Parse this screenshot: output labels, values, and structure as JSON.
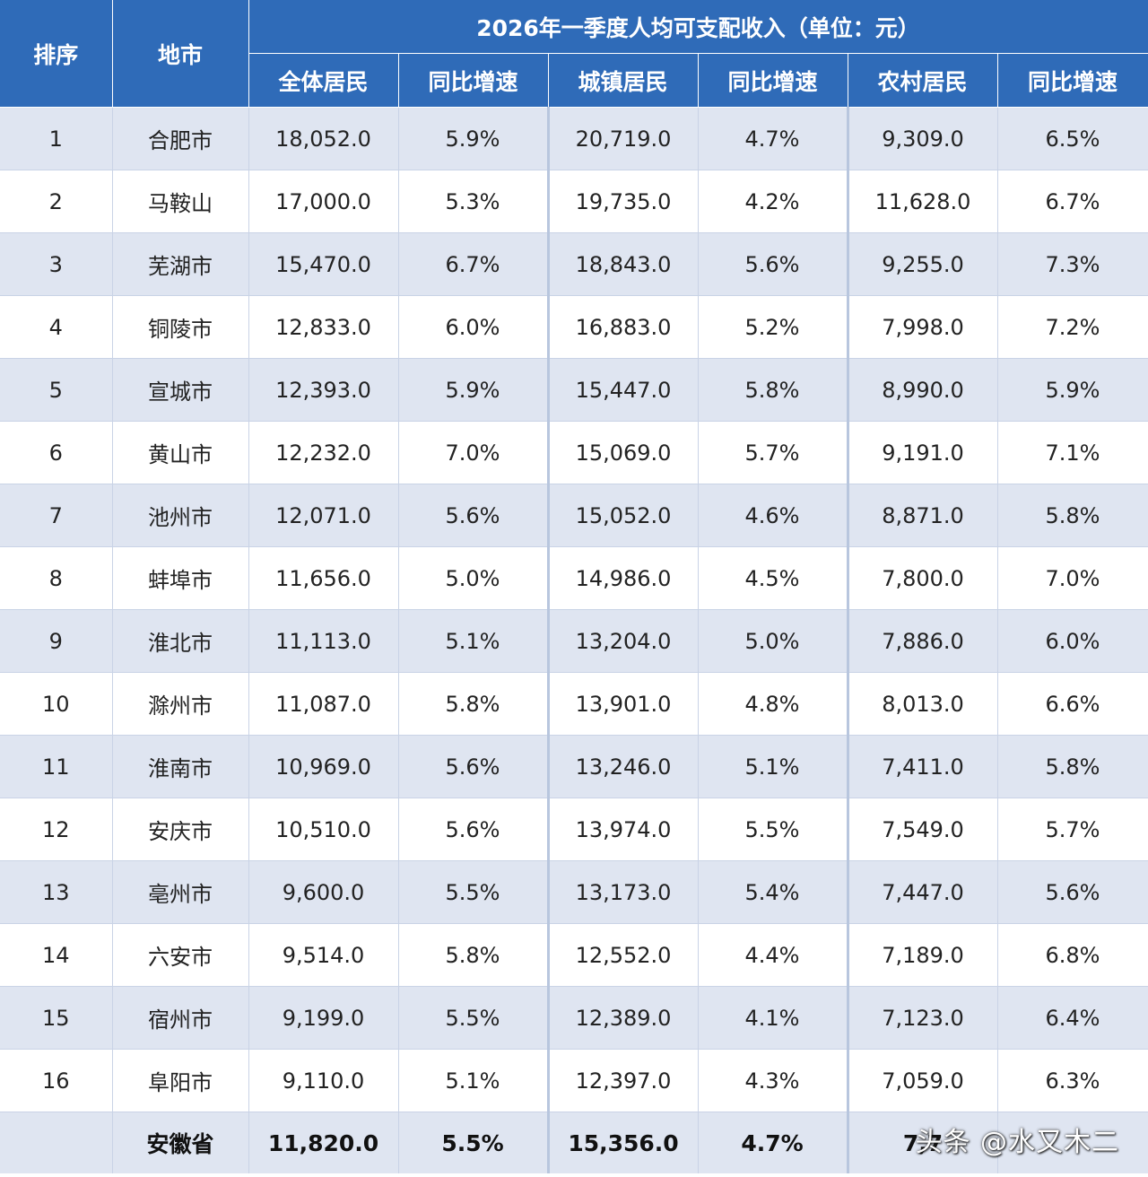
{
  "table": {
    "title": "2026年一季度人均可支配收入（单位：元）",
    "headers": {
      "rank": "排序",
      "city": "地市",
      "all": "全体居民",
      "all_growth": "同比增速",
      "urban": "城镇居民",
      "urban_growth": "同比增速",
      "rural": "农村居民",
      "rural_growth": "同比增速"
    },
    "rows": [
      {
        "rank": "1",
        "city": "合肥市",
        "all": "18,052.0",
        "all_growth": "5.9%",
        "urban": "20,719.0",
        "urban_growth": "4.7%",
        "rural": "9,309.0",
        "rural_growth": "6.5%"
      },
      {
        "rank": "2",
        "city": "马鞍山",
        "all": "17,000.0",
        "all_growth": "5.3%",
        "urban": "19,735.0",
        "urban_growth": "4.2%",
        "rural": "11,628.0",
        "rural_growth": "6.7%"
      },
      {
        "rank": "3",
        "city": "芜湖市",
        "all": "15,470.0",
        "all_growth": "6.7%",
        "urban": "18,843.0",
        "urban_growth": "5.6%",
        "rural": "9,255.0",
        "rural_growth": "7.3%"
      },
      {
        "rank": "4",
        "city": "铜陵市",
        "all": "12,833.0",
        "all_growth": "6.0%",
        "urban": "16,883.0",
        "urban_growth": "5.2%",
        "rural": "7,998.0",
        "rural_growth": "7.2%"
      },
      {
        "rank": "5",
        "city": "宣城市",
        "all": "12,393.0",
        "all_growth": "5.9%",
        "urban": "15,447.0",
        "urban_growth": "5.8%",
        "rural": "8,990.0",
        "rural_growth": "5.9%"
      },
      {
        "rank": "6",
        "city": "黄山市",
        "all": "12,232.0",
        "all_growth": "7.0%",
        "urban": "15,069.0",
        "urban_growth": "5.7%",
        "rural": "9,191.0",
        "rural_growth": "7.1%"
      },
      {
        "rank": "7",
        "city": "池州市",
        "all": "12,071.0",
        "all_growth": "5.6%",
        "urban": "15,052.0",
        "urban_growth": "4.6%",
        "rural": "8,871.0",
        "rural_growth": "5.8%"
      },
      {
        "rank": "8",
        "city": "蚌埠市",
        "all": "11,656.0",
        "all_growth": "5.0%",
        "urban": "14,986.0",
        "urban_growth": "4.5%",
        "rural": "7,800.0",
        "rural_growth": "7.0%"
      },
      {
        "rank": "9",
        "city": "淮北市",
        "all": "11,113.0",
        "all_growth": "5.1%",
        "urban": "13,204.0",
        "urban_growth": "5.0%",
        "rural": "7,886.0",
        "rural_growth": "6.0%"
      },
      {
        "rank": "10",
        "city": "滁州市",
        "all": "11,087.0",
        "all_growth": "5.8%",
        "urban": "13,901.0",
        "urban_growth": "4.8%",
        "rural": "8,013.0",
        "rural_growth": "6.6%"
      },
      {
        "rank": "11",
        "city": "淮南市",
        "all": "10,969.0",
        "all_growth": "5.6%",
        "urban": "13,246.0",
        "urban_growth": "5.1%",
        "rural": "7,411.0",
        "rural_growth": "5.8%"
      },
      {
        "rank": "12",
        "city": "安庆市",
        "all": "10,510.0",
        "all_growth": "5.6%",
        "urban": "13,974.0",
        "urban_growth": "5.5%",
        "rural": "7,549.0",
        "rural_growth": "5.7%"
      },
      {
        "rank": "13",
        "city": "亳州市",
        "all": "9,600.0",
        "all_growth": "5.5%",
        "urban": "13,173.0",
        "urban_growth": "5.4%",
        "rural": "7,447.0",
        "rural_growth": "5.6%"
      },
      {
        "rank": "14",
        "city": "六安市",
        "all": "9,514.0",
        "all_growth": "5.8%",
        "urban": "12,552.0",
        "urban_growth": "4.4%",
        "rural": "7,189.0",
        "rural_growth": "6.8%"
      },
      {
        "rank": "15",
        "city": "宿州市",
        "all": "9,199.0",
        "all_growth": "5.5%",
        "urban": "12,389.0",
        "urban_growth": "4.1%",
        "rural": "7,123.0",
        "rural_growth": "6.4%"
      },
      {
        "rank": "16",
        "city": "阜阳市",
        "all": "9,110.0",
        "all_growth": "5.1%",
        "urban": "12,397.0",
        "urban_growth": "4.3%",
        "rural": "7,059.0",
        "rural_growth": "6.3%"
      }
    ],
    "total": {
      "rank": "",
      "city": "安徽省",
      "all": "11,820.0",
      "all_growth": "5.5%",
      "urban": "15,356.0",
      "urban_growth": "4.7%",
      "rural": "7,7",
      "rural_growth": ""
    }
  },
  "watermark": "头条 @水又木二"
}
